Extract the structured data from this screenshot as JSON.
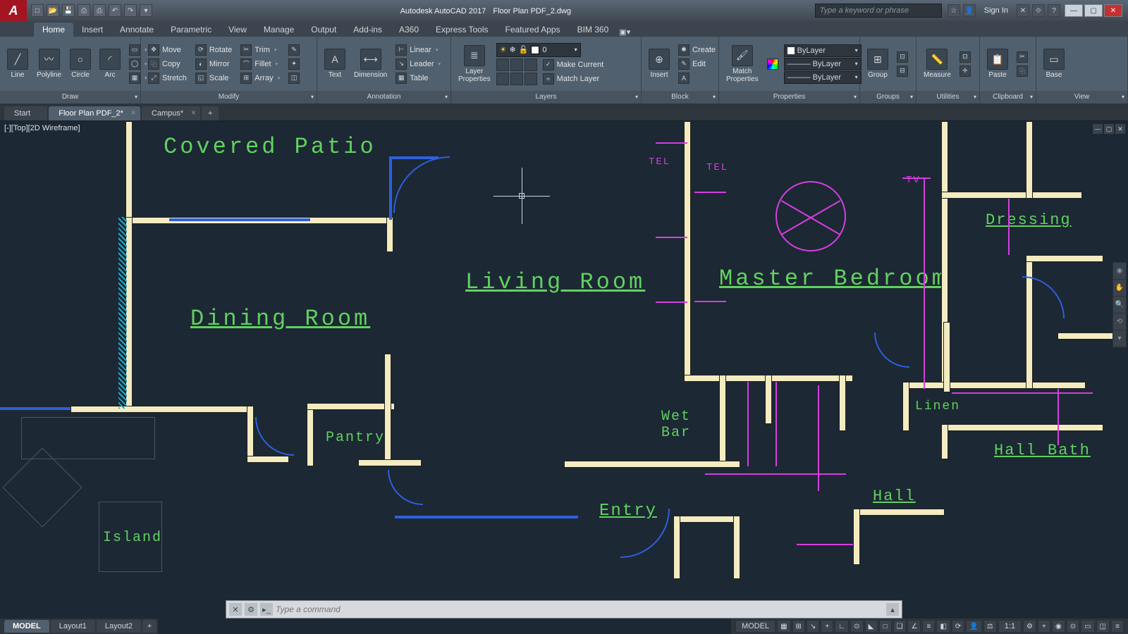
{
  "app": {
    "title_prefix": "Autodesk AutoCAD 2017",
    "document": "Floor Plan PDF_2.dwg",
    "logo": "A"
  },
  "qat": [
    "new",
    "open",
    "save",
    "saveall",
    "print",
    "undo",
    "redo",
    "cloud"
  ],
  "search": {
    "placeholder": "Type a keyword or phrase"
  },
  "signin": "Sign In",
  "menu": {
    "items": [
      "Home",
      "Insert",
      "Annotate",
      "Parametric",
      "View",
      "Manage",
      "Output",
      "Add-ins",
      "A360",
      "Express Tools",
      "Featured Apps",
      "BIM 360"
    ],
    "active": 0
  },
  "ribbon": {
    "draw": {
      "title": "Draw",
      "big": [
        {
          "lbl": "Line"
        },
        {
          "lbl": "Polyline"
        },
        {
          "lbl": "Circle"
        },
        {
          "lbl": "Arc"
        }
      ]
    },
    "modify": {
      "title": "Modify",
      "rows": [
        {
          "lbl": "Move",
          "dd": false
        },
        {
          "lbl": "Rotate",
          "dd": false
        },
        {
          "lbl": "Trim",
          "dd": true
        },
        {
          "lbl": "Copy",
          "dd": false
        },
        {
          "lbl": "Mirror",
          "dd": false
        },
        {
          "lbl": "Fillet",
          "dd": true
        },
        {
          "lbl": "Stretch",
          "dd": false
        },
        {
          "lbl": "Scale",
          "dd": false
        },
        {
          "lbl": "Array",
          "dd": true
        }
      ]
    },
    "annotation": {
      "title": "Annotation",
      "big": [
        {
          "lbl": "Text"
        },
        {
          "lbl": "Dimension"
        }
      ],
      "rows": [
        {
          "lbl": "Linear",
          "dd": true
        },
        {
          "lbl": "Leader",
          "dd": true
        },
        {
          "lbl": "Table",
          "dd": false
        }
      ]
    },
    "layers": {
      "title": "Layers",
      "big": {
        "lbl": "Layer\nProperties"
      },
      "current": "0",
      "rows": [
        {
          "lbl": "Make Current"
        },
        {
          "lbl": "Match Layer"
        }
      ]
    },
    "block": {
      "title": "Block",
      "big": {
        "lbl": "Insert"
      },
      "rows": [
        {
          "lbl": "Create"
        },
        {
          "lbl": "Edit"
        }
      ]
    },
    "properties": {
      "title": "Properties",
      "big": {
        "lbl": "Match\nProperties"
      },
      "combos": [
        "ByLayer",
        "ByLayer",
        "ByLayer"
      ]
    },
    "groups": {
      "title": "Groups",
      "big": {
        "lbl": "Group"
      }
    },
    "utilities": {
      "title": "Utilities",
      "big": {
        "lbl": "Measure"
      }
    },
    "clipboard": {
      "title": "Clipboard",
      "big": {
        "lbl": "Paste"
      }
    },
    "view": {
      "title": "View",
      "big": {
        "lbl": "Base"
      }
    }
  },
  "tabs": {
    "items": [
      {
        "lbl": "Start"
      },
      {
        "lbl": "Floor Plan PDF_2*"
      },
      {
        "lbl": "Campus*"
      }
    ],
    "active": 1
  },
  "viewport": {
    "label": "[-][Top][2D Wireframe]"
  },
  "rooms": {
    "covered_patio": "Covered  Patio",
    "living_room": "Living  Room",
    "master_bedroom": "Master  Bedroom",
    "dining_room": "Dining  Room",
    "dressing": "Dressing",
    "pantry": "Pantry",
    "wet_bar": "Wet\nBar",
    "linen": "Linen",
    "hall_bath": "Hall  Bath",
    "hall": "Hall",
    "entry": "Entry",
    "island": "Island",
    "tel": "TEL",
    "tv": "TV"
  },
  "command": {
    "placeholder": "Type a command"
  },
  "layouts": {
    "items": [
      "MODEL",
      "Layout1",
      "Layout2"
    ],
    "active": 0
  },
  "status": {
    "model": "MODEL",
    "scale": "1:1",
    "items": [
      "grid",
      "snap",
      "infer",
      "dyn",
      "ortho",
      "polar",
      "iso",
      "osnap",
      "3dosnap",
      "otrack",
      "lweight",
      "trans",
      "cycle",
      "ann-vis",
      "auto",
      "units",
      "qprops",
      "ws",
      "mon",
      "hw",
      "clean",
      "iso2",
      "full"
    ]
  }
}
